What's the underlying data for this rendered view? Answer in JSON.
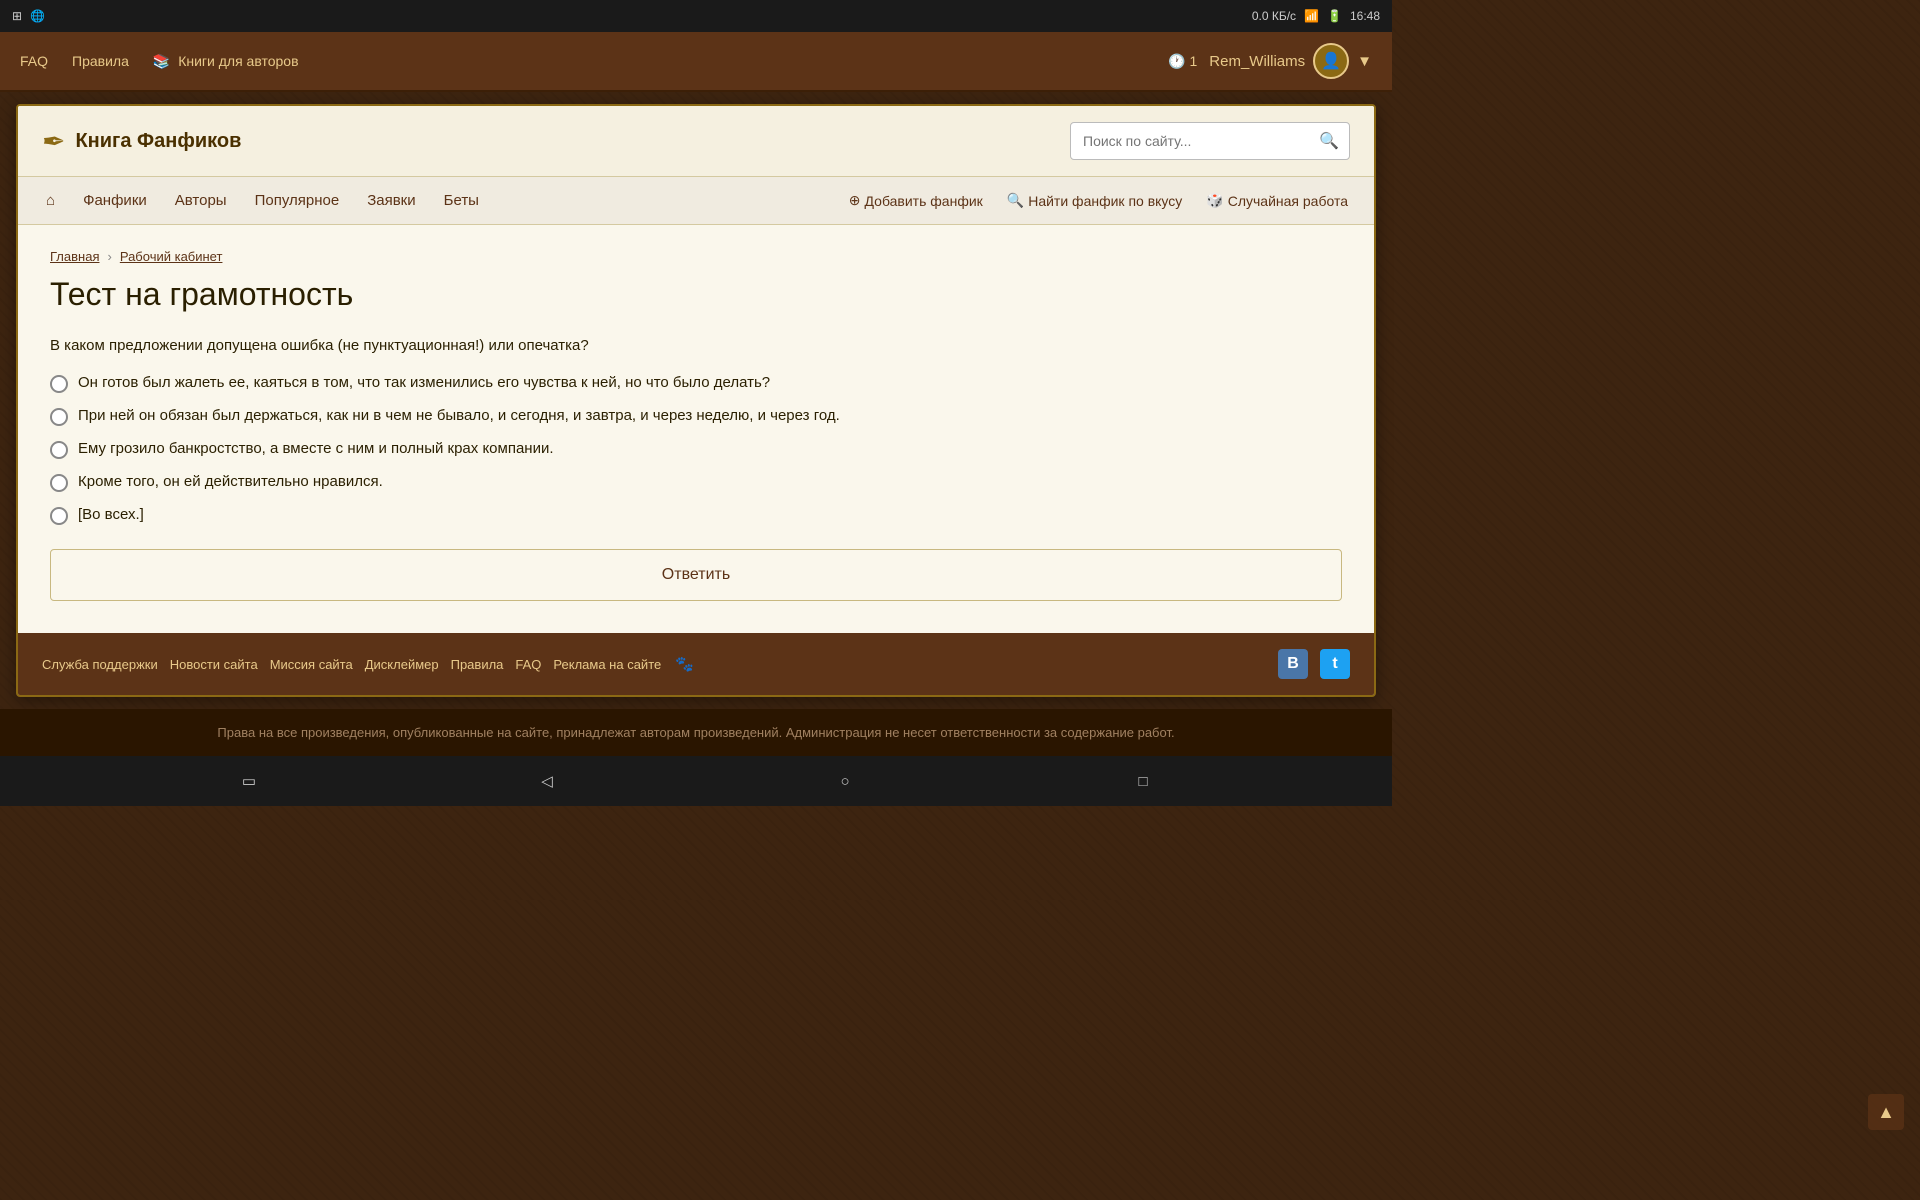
{
  "system_bar": {
    "left": "⊞",
    "network": "0.0 КБ/с",
    "time": "16:48"
  },
  "nav_bar": {
    "faq": "FAQ",
    "rules": "Правила",
    "books_icon": "📚",
    "books": "Книги для авторов",
    "notifications": "1",
    "username": "Rem_Williams"
  },
  "site_header": {
    "logo_icon": "✒",
    "logo_text": "Книга Фанфиков",
    "search_placeholder": "Поиск по сайту..."
  },
  "site_nav": {
    "home_icon": "⌂",
    "fanfics": "Фанфики",
    "authors": "Авторы",
    "popular": "Популярное",
    "requests": "Заявки",
    "betas": "Беты",
    "add_fanfic": "Добавить фанфик",
    "find_fanfic": "Найти фанфик по вкусу",
    "random": "Случайная работа"
  },
  "breadcrumb": {
    "home": "Главная",
    "cabinet": "Рабочий кабинет"
  },
  "page": {
    "title": "Тест на грамотность",
    "question": "В каком предложении допущена ошибка (не пунктуационная!) или опечатка?",
    "options": [
      "Он готов был жалеть ее, каяться в том, что так изменились его чувства к ней, но что было делать?",
      "При ней он обязан был держаться, как ни в чем не бывало, и сегодня, и завтра, и через неделю, и через год.",
      "Ему грозило банкростство, а вместе с ним и полный крах компании.",
      "Кроме того, он ей действительно нравился.",
      "[Во всех.]"
    ],
    "answer_button": "Ответить"
  },
  "footer": {
    "links": [
      "Служба поддержки",
      "Новости сайта",
      "Миссия сайта",
      "Дисклеймер",
      "Правила",
      "FAQ",
      "Реклама на сайте"
    ],
    "paw_icon": "🐾"
  },
  "copyright": {
    "text": "Права на все произведения, опубликованные на сайте, принадлежат авторам произведений. Администрация не несет ответственности за содержание работ."
  },
  "android_bar": {
    "square_icon": "▭",
    "back_icon": "◁",
    "home_icon": "○",
    "recent_icon": "□"
  }
}
